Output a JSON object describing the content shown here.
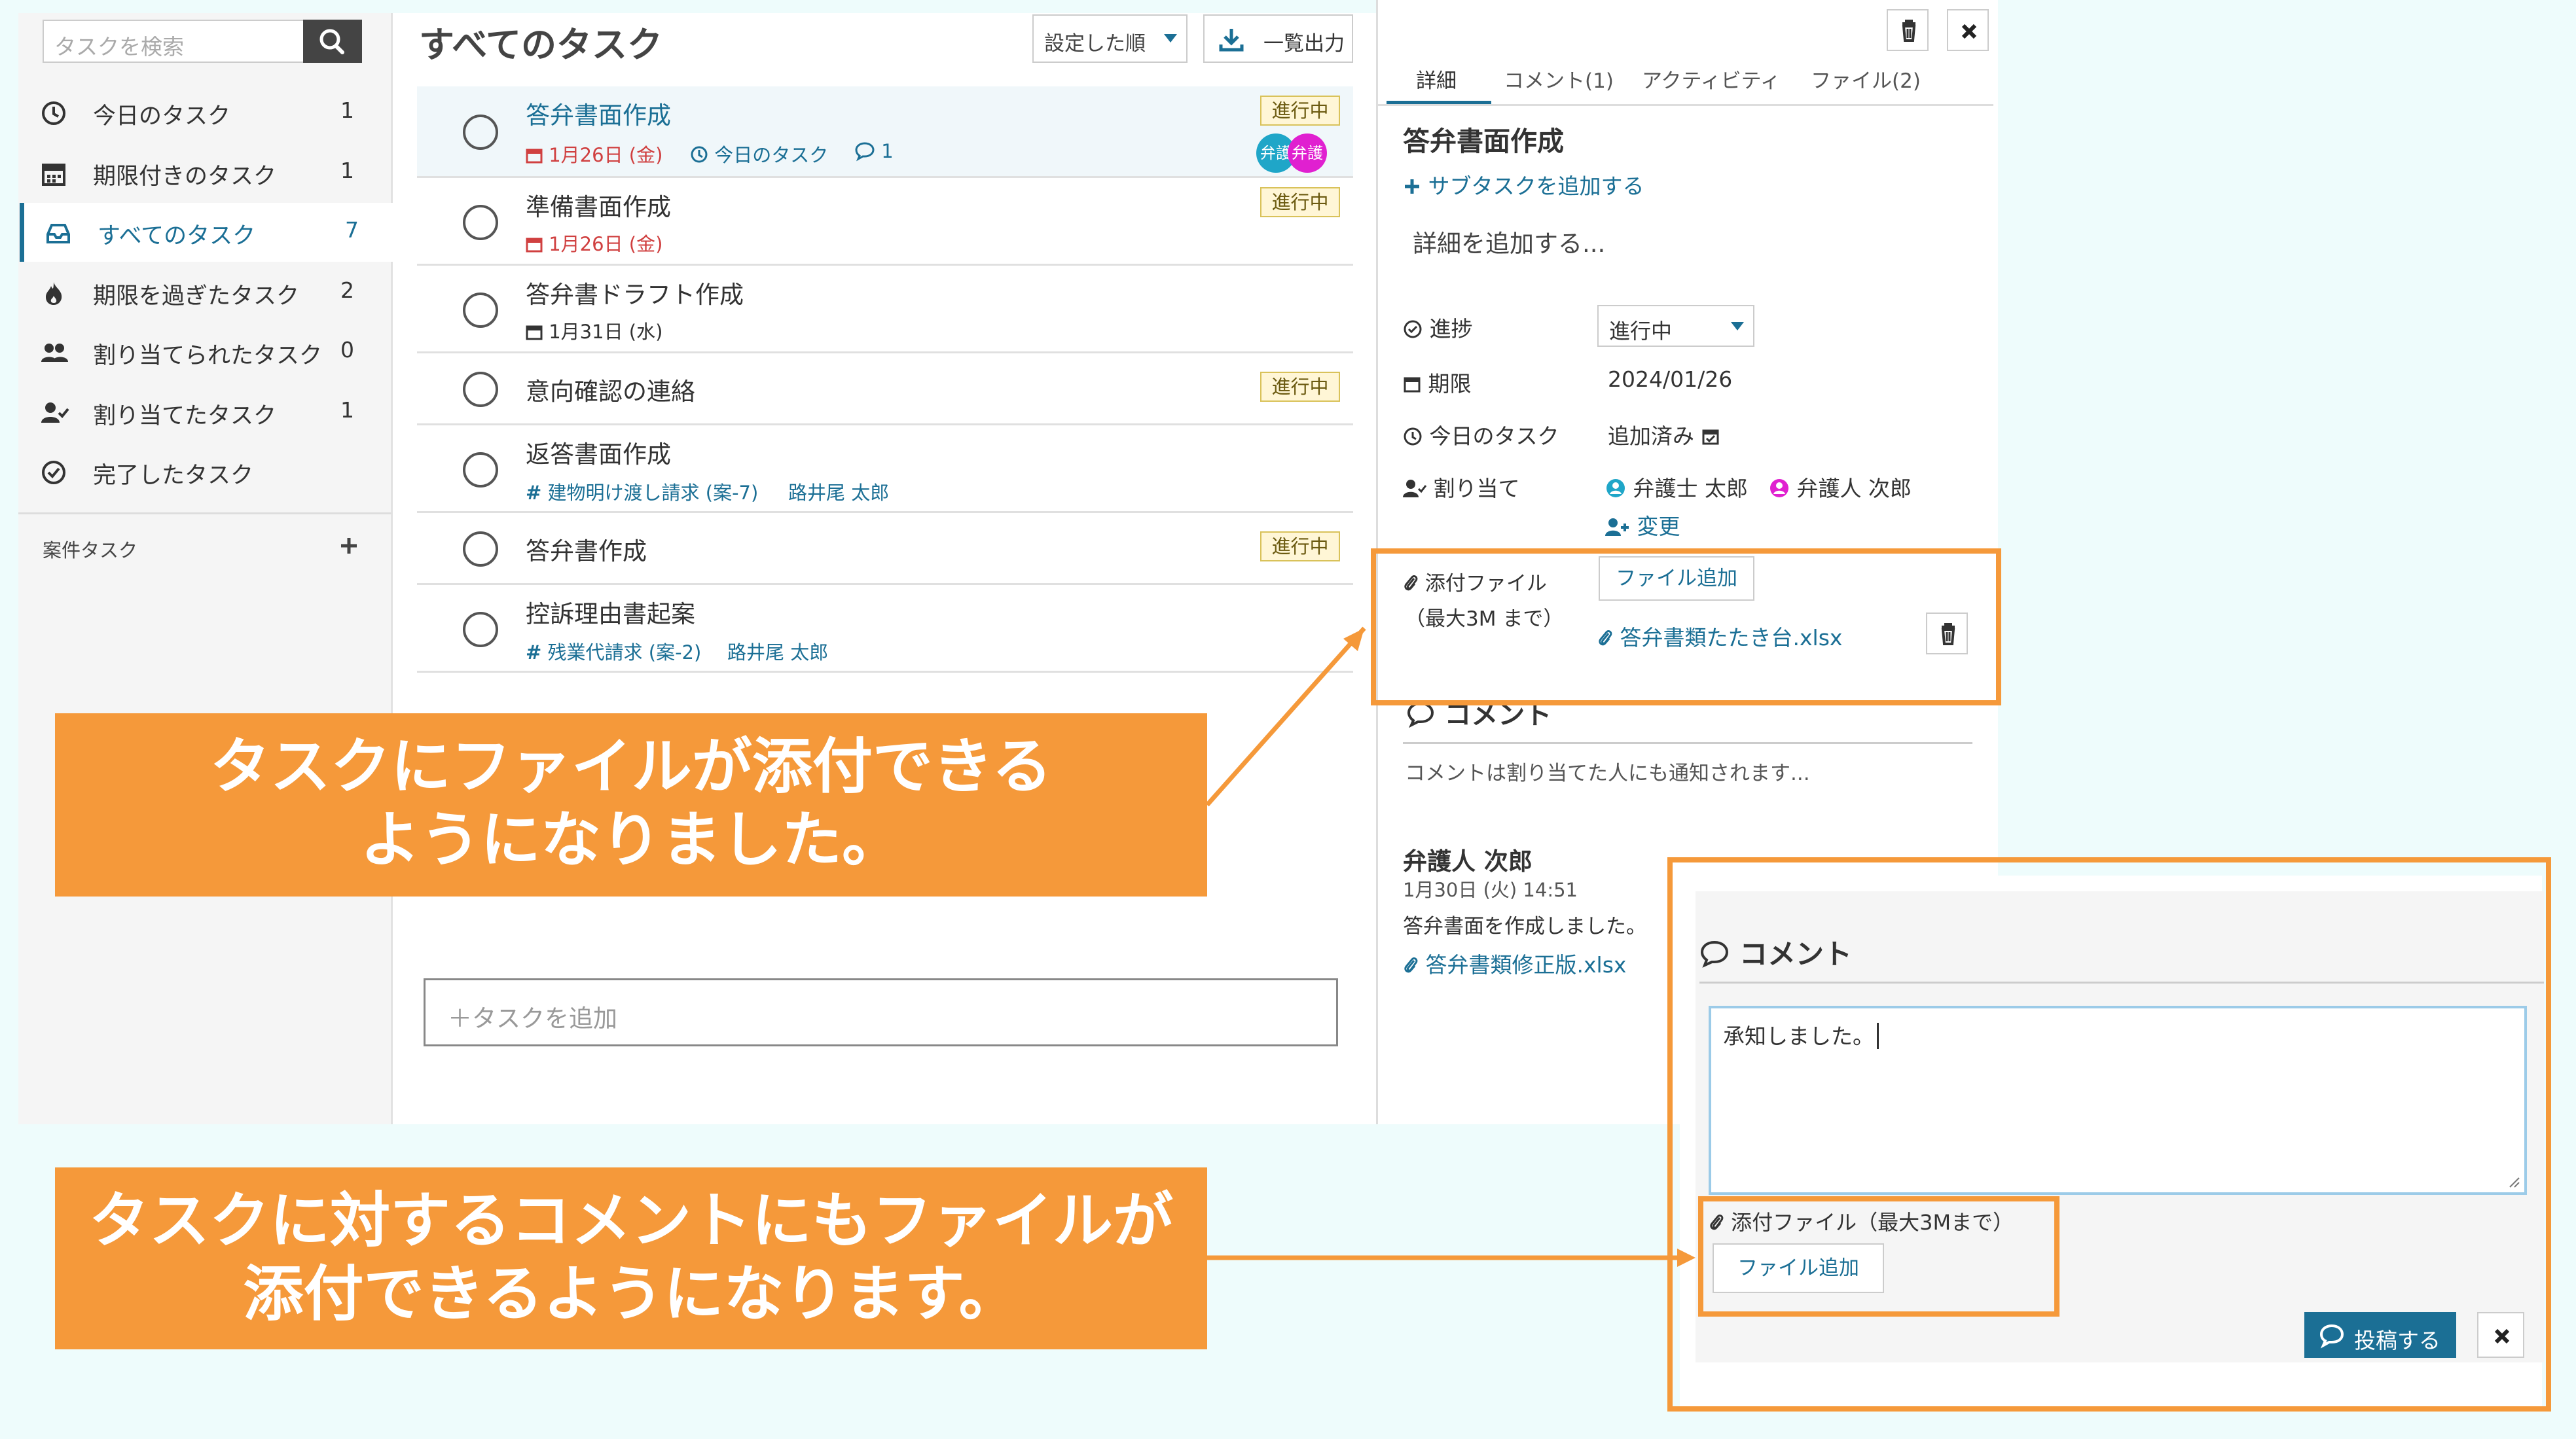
{
  "sidebar": {
    "search_placeholder": "タスクを検索",
    "items": [
      {
        "label": "今日のタスク",
        "count": "1",
        "icon": "clock-icon"
      },
      {
        "label": "期限付きのタスク",
        "count": "1",
        "icon": "calendar-icon"
      },
      {
        "label": "すべてのタスク",
        "count": "7",
        "icon": "inbox-icon"
      },
      {
        "label": "期限を過ぎたタスク",
        "count": "2",
        "icon": "fire-icon"
      },
      {
        "label": "割り当てられたタスク",
        "count": "0",
        "icon": "users-icon"
      },
      {
        "label": "割り当てたタスク",
        "count": "1",
        "icon": "user-check-icon"
      },
      {
        "label": "完了したタスク",
        "count": "",
        "icon": "check-circle-icon"
      }
    ],
    "case_tasks_label": "案件タスク"
  },
  "main": {
    "title": "すべてのタスク",
    "sort_label": "設定した順",
    "export_label": "一覧出力",
    "add_task_placeholder": "＋タスクを追加",
    "tasks": [
      {
        "title": "答弁書面作成",
        "due": "1月26日 (金)",
        "today": "今日のタスク",
        "comments": "1",
        "status": "進行中",
        "avatars": [
          "弁護",
          "弁護"
        ]
      },
      {
        "title": "準備書面作成",
        "due": "1月26日 (金)",
        "status": "進行中"
      },
      {
        "title": "答弁書ドラフト作成",
        "due": "1月31日 (水)"
      },
      {
        "title": "意向確認の連絡",
        "status": "進行中"
      },
      {
        "title": "返答書面作成",
        "case": "建物明け渡し請求 (案-7)",
        "person": "路井尾 太郎"
      },
      {
        "title": "答弁書作成",
        "status": "進行中"
      },
      {
        "title": "控訴理由書起案",
        "case": "残業代請求 (案-2)",
        "person": "路井尾 太郎"
      }
    ]
  },
  "detail": {
    "tabs": [
      "詳細",
      "コメント(1)",
      "アクティビティ",
      "ファイル(2)"
    ],
    "title": "答弁書面作成",
    "add_subtask": "サブタスクを追加する",
    "description_placeholder": "詳細を追加する...",
    "progress_label": "進捗",
    "progress_value": "進行中",
    "due_label": "期限",
    "due_value": "2024/01/26",
    "today_label": "今日のタスク",
    "today_value": "追加済み",
    "assign_label": "割り当て",
    "assignees": [
      "弁護士 太郎",
      "弁護人 次郎"
    ],
    "change_label": "変更",
    "attach_label": "添付ファイル",
    "attach_limit": "（最大3M まで）",
    "attach_button": "ファイル追加",
    "attached_file": "答弁書類たたき台.xlsx",
    "comment_heading": "コメント",
    "comment_placeholder": "コメントは割り当てた人にも通知されます...",
    "comment": {
      "author": "弁護人 次郎",
      "time": "1月30日 (火) 14:51",
      "body": "答弁書面を作成しました。",
      "file": "答弁書類修正版.xlsx"
    }
  },
  "comment_panel": {
    "heading": "コメント",
    "text": "承知しました。",
    "attach_label": "添付ファイル（最大3Mまで）",
    "attach_button": "ファイル追加",
    "post_button": "投稿する"
  },
  "callouts": {
    "first_line1": "タスクにファイルが添付できる",
    "first_line2": "ようになりました。",
    "second_line1": "タスクに対するコメントにもファイルが",
    "second_line2": "添付できるようになります。"
  },
  "colors": {
    "accent": "#1b6f95",
    "callout": "#f5993a",
    "due_red": "#d04040",
    "status_bg": "#fff6d6",
    "avatar_teal": "#1fa6c8",
    "avatar_magenta": "#e020d0"
  }
}
